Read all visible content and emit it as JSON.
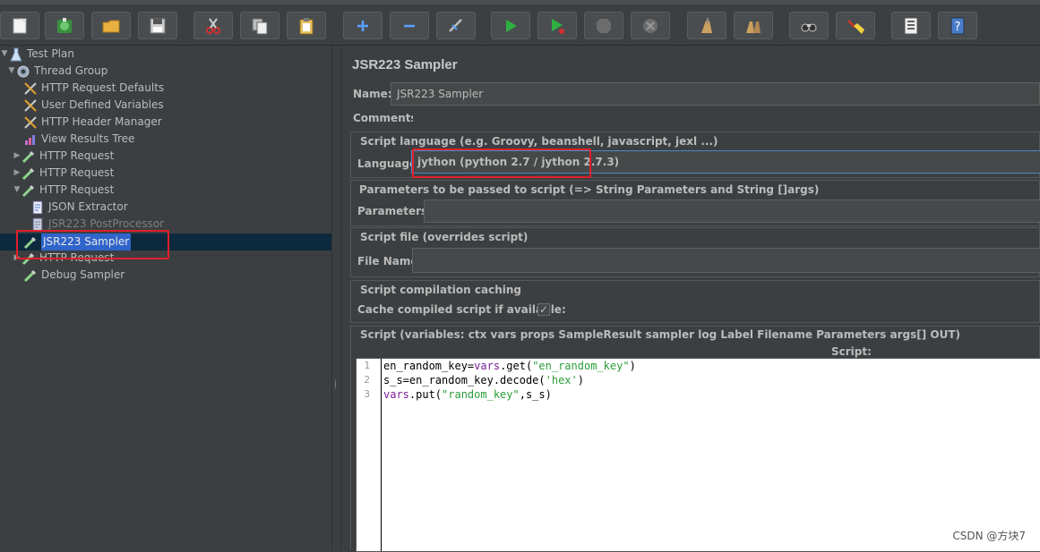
{
  "toolbar": {
    "buttons": [
      {
        "name": "new-icon",
        "color": "#f4f4f4"
      },
      {
        "name": "templates-icon",
        "color": "#4caf50"
      },
      {
        "name": "open-icon",
        "color": "#e8b040"
      },
      {
        "name": "save-icon",
        "color": "#cfcfcf"
      },
      {
        "name": "cut-icon",
        "color": "#d03030"
      },
      {
        "name": "copy-icon",
        "color": "#e0e0e0"
      },
      {
        "name": "paste-icon",
        "color": "#e8c060"
      },
      {
        "name": "expand-icon",
        "color": "#5aa0ff"
      },
      {
        "name": "collapse-icon",
        "color": "#5aa0ff"
      },
      {
        "name": "toggle-icon",
        "color": "#bbbbbb"
      },
      {
        "name": "start-icon",
        "color": "#2fb040"
      },
      {
        "name": "start-no-pause-icon",
        "color": "#2fb040"
      },
      {
        "name": "stop-icon",
        "color": "#777777"
      },
      {
        "name": "shutdown-icon",
        "color": "#777777"
      },
      {
        "name": "clear-icon",
        "color": "#c8a060"
      },
      {
        "name": "clear-all-icon",
        "color": "#c8a060"
      },
      {
        "name": "search-icon",
        "color": "#cccccc"
      },
      {
        "name": "reset-search-icon",
        "color": "#f0d040"
      },
      {
        "name": "function-helper-icon",
        "color": "#e0e0e0"
      },
      {
        "name": "help-icon",
        "color": "#4a7cc8"
      }
    ]
  },
  "tree": {
    "nodes": [
      {
        "label": "Test Plan",
        "icon": "test-plan-icon"
      },
      {
        "label": "Thread Group",
        "icon": "gear-icon"
      },
      {
        "label": "HTTP Request Defaults",
        "icon": "config-tool-icon"
      },
      {
        "label": "User Defined Variables",
        "icon": "config-tool-icon"
      },
      {
        "label": "HTTP Header Manager",
        "icon": "config-tool-icon"
      },
      {
        "label": "View Results Tree",
        "icon": "chart-icon"
      },
      {
        "label": "HTTP Request",
        "icon": "pipette-icon"
      },
      {
        "label": "HTTP Request",
        "icon": "pipette-icon"
      },
      {
        "label": "HTTP Request",
        "icon": "pipette-icon"
      },
      {
        "label": "JSON Extractor",
        "icon": "document-icon"
      },
      {
        "label": "JSR223 PostProcessor",
        "icon": "document-icon"
      },
      {
        "label": "JSR223 Sampler",
        "icon": "pipette-icon"
      },
      {
        "label": "HTTP Request",
        "icon": "pipette-icon"
      },
      {
        "label": "Debug Sampler",
        "icon": "pipette-icon"
      }
    ]
  },
  "panel": {
    "title": "JSR223 Sampler",
    "name_label": "Name:",
    "name_value": "JSR223 Sampler",
    "comments_label": "Comments:",
    "lang_group_title": "Script language (e.g. Groovy, beanshell, javascript, jexl ...)",
    "lang_label": "Language:",
    "lang_value": "jython     (python 2.7 / jython 2.7.3)",
    "params_group_title": "Parameters to be passed to script (=> String Parameters and String []args)",
    "params_label": "Parameters:",
    "file_group_title": "Script file (overrides script)",
    "file_label": "File Name:",
    "cache_group_title": "Script compilation caching",
    "cache_label": "Cache compiled script if available:",
    "cache_checked": true,
    "script_group_title": "Script (variables: ctx vars props SampleResult sampler log Label Filename Parameters args[] OUT)",
    "script_label": "Script:"
  },
  "script": {
    "line_numbers": [
      "1",
      "2",
      "3"
    ],
    "lines": [
      {
        "parts": [
          {
            "t": "en_random_key=",
            "c": "plain"
          },
          {
            "t": "vars",
            "c": "kw"
          },
          {
            "t": ".get(",
            "c": "plain"
          },
          {
            "t": "\"en_random_key\"",
            "c": "str"
          },
          {
            "t": ")",
            "c": "plain"
          }
        ]
      },
      {
        "parts": [
          {
            "t": "s_s=en_random_key.decode(",
            "c": "plain"
          },
          {
            "t": "'hex'",
            "c": "str"
          },
          {
            "t": ")",
            "c": "plain"
          }
        ]
      },
      {
        "parts": [
          {
            "t": "vars",
            "c": "kw"
          },
          {
            "t": ".put(",
            "c": "plain"
          },
          {
            "t": "\"random_key\"",
            "c": "str"
          },
          {
            "t": ",s_s)",
            "c": "plain"
          }
        ]
      }
    ]
  },
  "watermark": "CSDN @方块7"
}
